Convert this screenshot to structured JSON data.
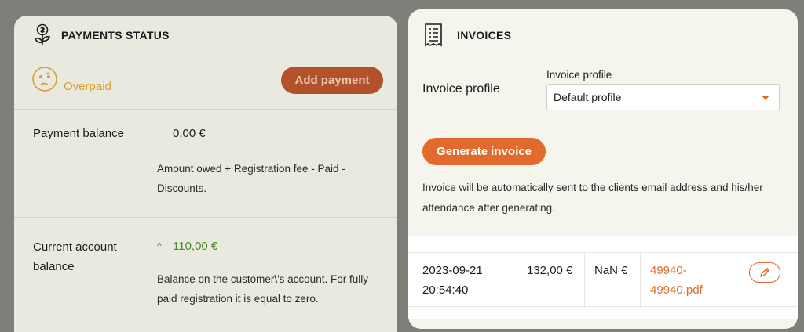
{
  "payments": {
    "title": "PAYMENTS STATUS",
    "status_text": "Overpaid",
    "add_payment_label": "Add payment",
    "balance": {
      "label": "Payment balance",
      "value": "0,00 €",
      "description": "Amount owed + Registration fee - Paid - Discounts."
    },
    "account": {
      "label": "Current account balance",
      "arrow": "^",
      "value": "110,00 €",
      "description": "Balance on the customer\\'s account. For fully paid registration it is equal to zero."
    }
  },
  "invoices": {
    "title": "INVOICES",
    "profile_label": "Invoice profile",
    "select_label": "Invoice profile",
    "select_value": "Default profile",
    "generate_label": "Generate invoice",
    "note": "Invoice will be automatically sent to the clients email address and his/her attendance after generating.",
    "rows": [
      {
        "date": "2023-09-21 20:54:40",
        "amount": "132,00 €",
        "other": "NaN €",
        "file": "49940-49940.pdf"
      }
    ]
  },
  "colors": {
    "accent": "#e26a2c",
    "status_overpaid": "#d2a12f",
    "positive": "#4b8a2a"
  },
  "icons": [
    "money-plant-icon",
    "confused-face-icon",
    "receipt-icon",
    "pencil-icon",
    "caret-down-icon"
  ]
}
